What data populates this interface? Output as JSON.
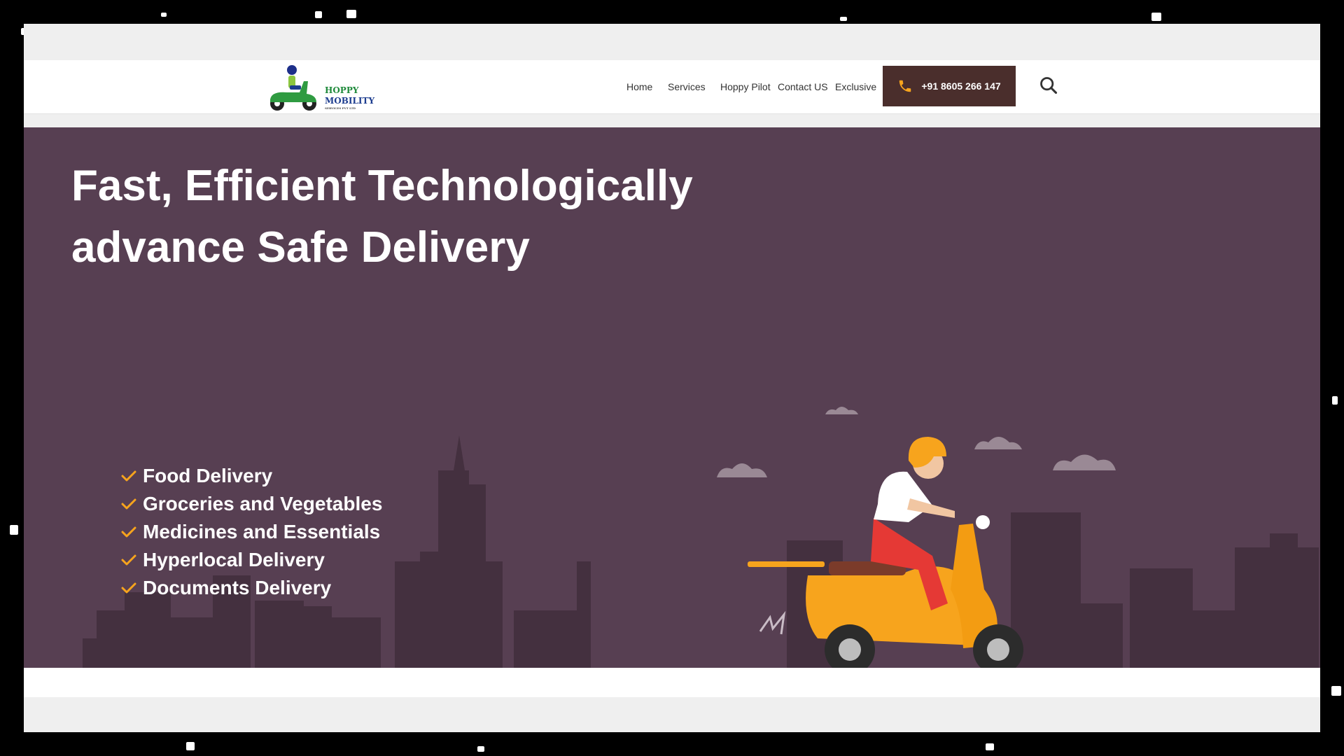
{
  "brand": {
    "name_line1": "HOPPY",
    "name_line2": "MOBILITY",
    "name_line3": "SERVICES PVT LTD"
  },
  "nav": {
    "items": [
      "Home",
      "Services",
      "Hoppy Pilot",
      "Contact US",
      "Exclusive"
    ],
    "phone": "+91 8605 266 147"
  },
  "hero": {
    "title_line1": "Fast, Efficient Technologically",
    "title_line2": "advance Safe Delivery",
    "services": [
      "Food Delivery",
      "Groceries and Vegetables",
      "Medicines and Essentials",
      "Hyperlocal Delivery",
      "Documents Delivery"
    ]
  },
  "colors": {
    "hero_bg": "#573f52",
    "skyline": "#44303f",
    "accent": "#f7a41d",
    "phone_button": "#4a2e2c"
  },
  "icons": [
    "phone-icon",
    "search-icon",
    "check-icon"
  ]
}
